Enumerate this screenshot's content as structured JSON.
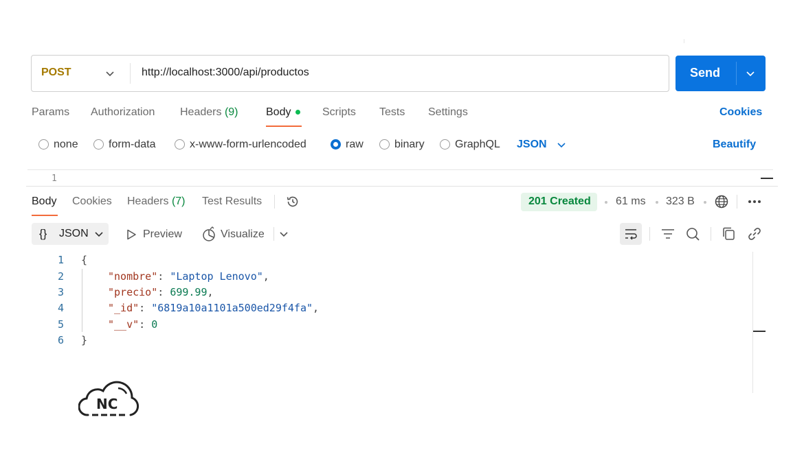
{
  "request": {
    "method": "POST",
    "url": "http://localhost:3000/api/productos",
    "send_label": "Send"
  },
  "request_tabs": {
    "params": "Params",
    "authorization": "Authorization",
    "headers": "Headers",
    "headers_count": "(9)",
    "body": "Body",
    "scripts": "Scripts",
    "tests": "Tests",
    "settings": "Settings",
    "cookies": "Cookies"
  },
  "body_types": {
    "none": "none",
    "form_data": "form-data",
    "urlencoded": "x-www-form-urlencoded",
    "raw": "raw",
    "binary": "binary",
    "graphql": "GraphQL",
    "selected": "raw",
    "language": "JSON",
    "beautify": "Beautify"
  },
  "request_editor": {
    "first_line_number": "1"
  },
  "response_tabs": {
    "body": "Body",
    "cookies": "Cookies",
    "headers": "Headers",
    "headers_count": "(7)",
    "test_results": "Test Results"
  },
  "response_meta": {
    "status": "201 Created",
    "time": "61 ms",
    "size": "323 B",
    "status_color": "#07873d"
  },
  "response_toolbar": {
    "format_braces": "{}",
    "format": "JSON",
    "preview": "Preview",
    "visualize": "Visualize"
  },
  "response_body": {
    "line_numbers": [
      "1",
      "2",
      "3",
      "4",
      "5",
      "6"
    ],
    "open_brace": "{",
    "close_brace": "}",
    "fields": [
      {
        "key": "\"nombre\"",
        "value": "\"Laptop Lenovo\"",
        "type": "string",
        "comma": ","
      },
      {
        "key": "\"precio\"",
        "value": "699.99",
        "type": "number",
        "comma": ","
      },
      {
        "key": "\"_id\"",
        "value": "\"6819a10a1101a500ed29f4fa\"",
        "type": "string",
        "comma": ","
      },
      {
        "key": "\"__v\"",
        "value": "0",
        "type": "number",
        "comma": ""
      }
    ]
  },
  "logo": {
    "text": "NC",
    "icon": "cloud-logo-icon"
  },
  "colors": {
    "accent": "#0a74e0",
    "method": "#a57a00",
    "tab_underline": "#f26b3a",
    "status_bg": "#e6f5ea"
  }
}
